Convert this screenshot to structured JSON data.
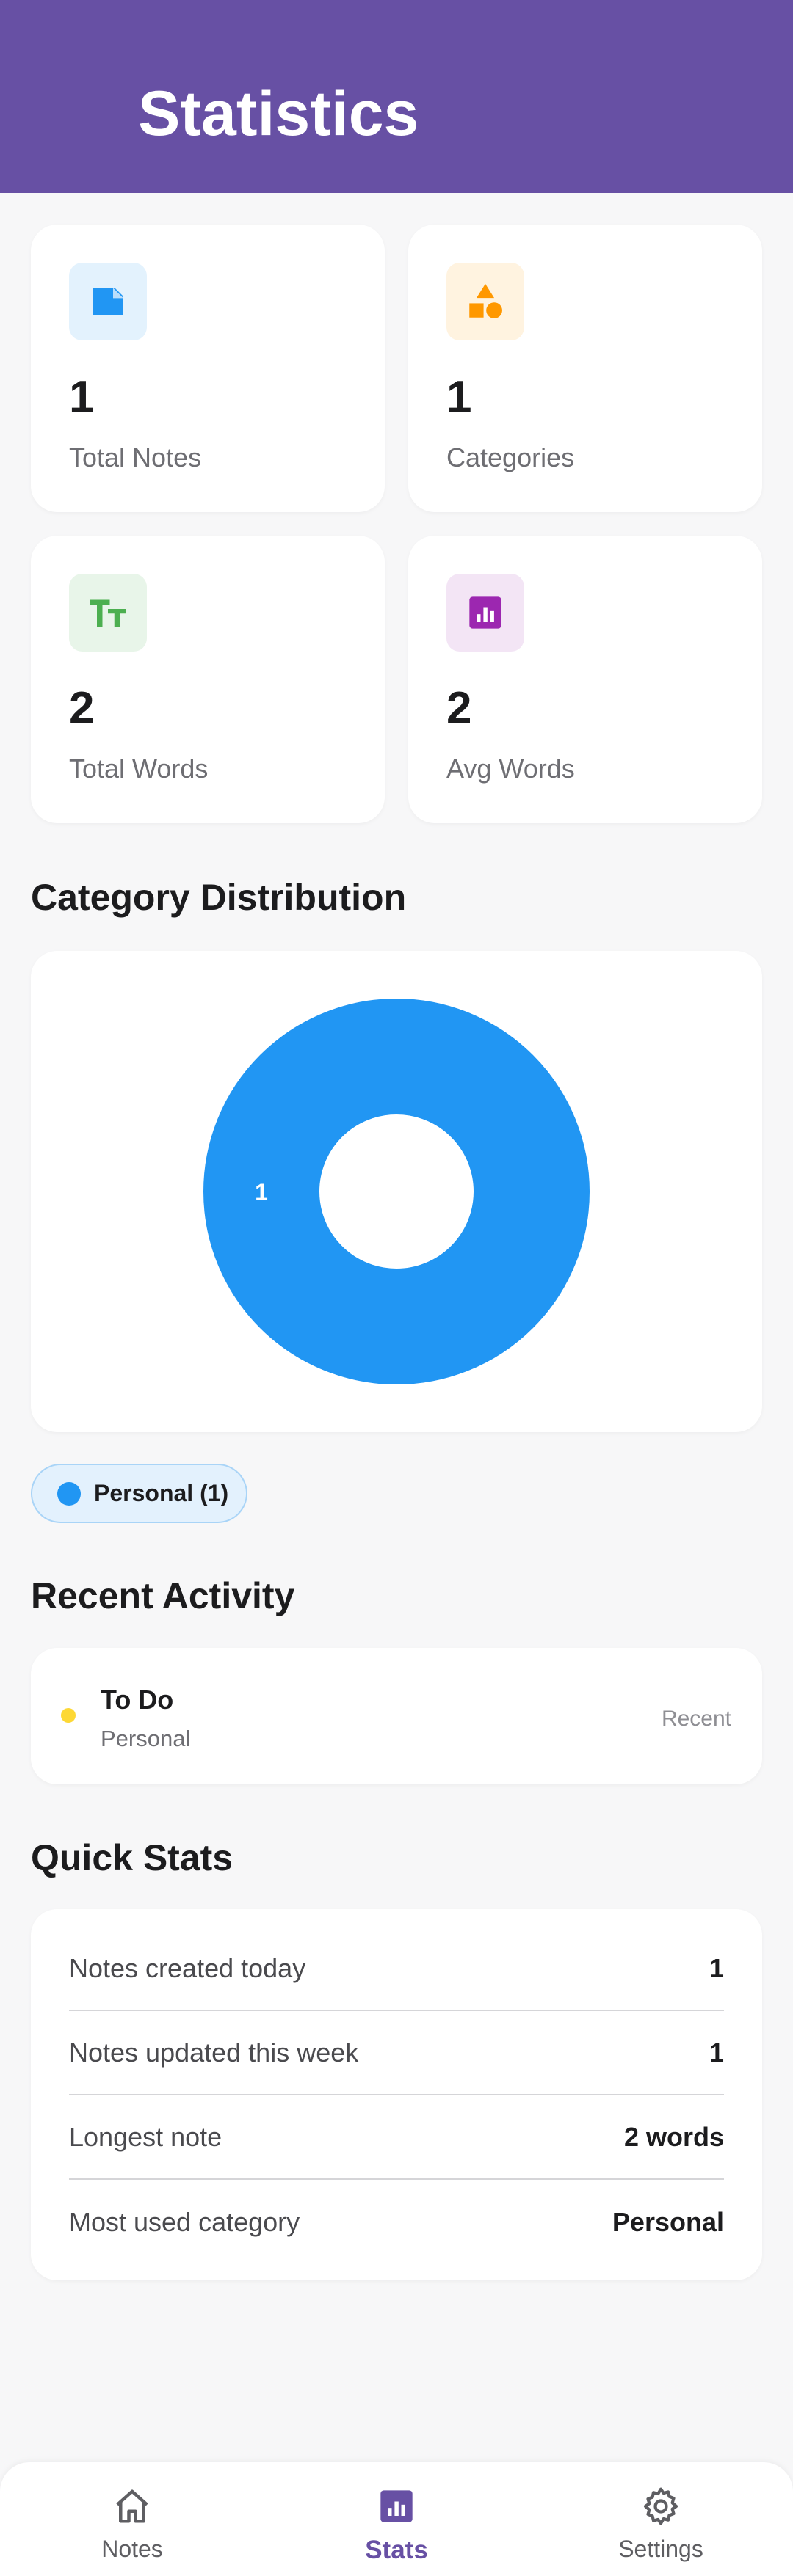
{
  "header": {
    "title": "Statistics"
  },
  "stats": [
    {
      "value": "1",
      "label": "Total Notes",
      "icon": "note-icon",
      "icon_color": "#2196f3",
      "icon_bg": "#e3f2fd"
    },
    {
      "value": "1",
      "label": "Categories",
      "icon": "shapes-icon",
      "icon_color": "#ff9800",
      "icon_bg": "#fff3e0"
    },
    {
      "value": "2",
      "label": "Total Words",
      "icon": "text-size-icon",
      "icon_color": "#4caf50",
      "icon_bg": "#e8f5e9"
    },
    {
      "value": "2",
      "label": "Avg Words",
      "icon": "bar-chart-icon",
      "icon_color": "#9c27b0",
      "icon_bg": "#f3e5f5"
    }
  ],
  "category_distribution": {
    "title": "Category Distribution",
    "legend": [
      {
        "label": "Personal (1)",
        "color": "#2196f3"
      }
    ]
  },
  "chart_data": {
    "type": "pie",
    "categories": [
      "Personal"
    ],
    "values": [
      1
    ],
    "colors": [
      "#2196f3"
    ],
    "data_labels": [
      "1"
    ],
    "donut": true
  },
  "recent_activity": {
    "title": "Recent Activity",
    "items": [
      {
        "title": "To Do",
        "category": "Personal",
        "time": "Recent",
        "dot_color": "#fdd835"
      }
    ]
  },
  "quick_stats": {
    "title": "Quick Stats",
    "rows": [
      {
        "label": "Notes created today",
        "value": "1"
      },
      {
        "label": "Notes updated this week",
        "value": "1"
      },
      {
        "label": "Longest note",
        "value": "2 words"
      },
      {
        "label": "Most used category",
        "value": "Personal"
      }
    ]
  },
  "bottom_nav": {
    "items": [
      {
        "label": "Notes",
        "icon": "home-icon"
      },
      {
        "label": "Stats",
        "icon": "bar-chart-icon",
        "active": true
      },
      {
        "label": "Settings",
        "icon": "gear-icon"
      }
    ],
    "accent": "#6750a4"
  },
  "colors": {
    "brand": "#6750a4",
    "background": "#f7f7f8"
  }
}
